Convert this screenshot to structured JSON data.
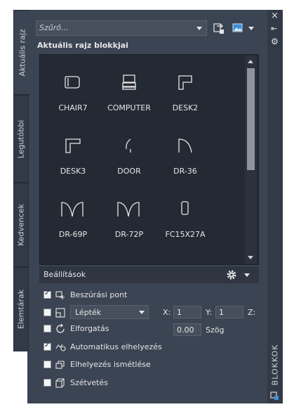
{
  "tabs": [
    {
      "label": "Aktuális rajz",
      "active": true
    },
    {
      "label": "Legutóbbi",
      "active": false
    },
    {
      "label": "Kedvencek",
      "active": false
    },
    {
      "label": "Elemtárak",
      "active": false
    }
  ],
  "filter": {
    "placeholder": "Szűrő..."
  },
  "heading": "Aktuális rajz blokkjai",
  "blocks": [
    {
      "label": "CHAIR7",
      "icon": "chair-icon"
    },
    {
      "label": "COMPUTER",
      "icon": "computer-icon"
    },
    {
      "label": "DESK2",
      "icon": "desk-icon"
    },
    {
      "label": "DESK3",
      "icon": "desk-icon"
    },
    {
      "label": "DOOR",
      "icon": "door-icon"
    },
    {
      "label": "DR-36",
      "icon": "door-icon"
    },
    {
      "label": "DR-69P",
      "icon": "double-door-icon"
    },
    {
      "label": "DR-72P",
      "icon": "double-door-icon"
    },
    {
      "label": "FC15X27A",
      "icon": "cabinet-icon"
    }
  ],
  "settings": {
    "title": "Beállítások",
    "insertion_point": {
      "label": "Beszúrási pont",
      "checked": true
    },
    "scale": {
      "value": "Lépték",
      "checked": false
    },
    "x_label": "X:",
    "x_value": "1",
    "y_label": "Y:",
    "y_value": "1",
    "z_label": "Z:",
    "rotation": {
      "label": "Elforgatás",
      "checked": false,
      "value": "0.00",
      "unit": "Szög"
    },
    "auto_place": {
      "label": "Automatikus elhelyezés",
      "checked": true
    },
    "repeat_place": {
      "label": "Elhelyezés ismétlése",
      "checked": false
    },
    "explode": {
      "label": "Szétvetés",
      "checked": false
    }
  },
  "side_title": "BLOKKOK",
  "titlebar": {
    "close": "×",
    "pin": "⇤",
    "properties": "⚙"
  }
}
